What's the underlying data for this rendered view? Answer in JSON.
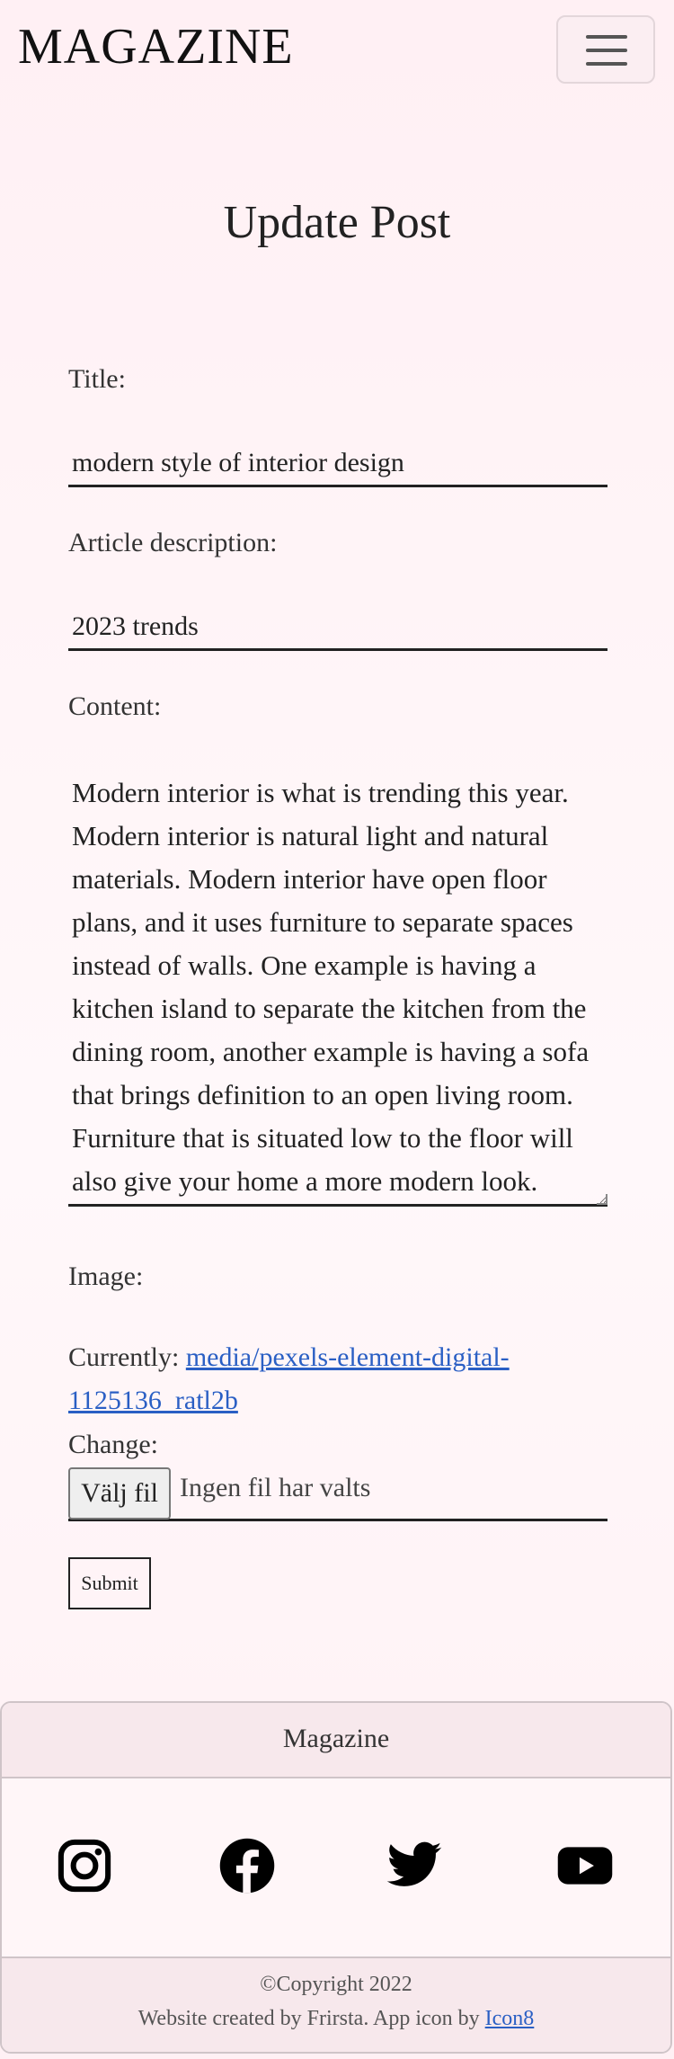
{
  "navbar": {
    "brand": "MAGAZINE",
    "toggler_icon": "hamburger-icon"
  },
  "page": {
    "title": "Update Post"
  },
  "form": {
    "title_label": "Title:",
    "title_value": "modern style of interior design",
    "description_label": "Article description:",
    "description_value": "2023 trends",
    "content_label": "Content:",
    "content_value": "Modern interior is what is trending this year. Modern interior is natural light and natural materials. Modern interior have open floor plans, and it uses furniture to separate spaces instead of walls. One example is having a kitchen island to separate the kitchen from the dining room, another example is having a sofa that brings definition to an open living room. Furniture that is situated low to the floor will also give your home a more modern look.",
    "image_label": "Image:",
    "currently_label": "Currently:",
    "current_file": "media/pexels-element-digital-1125136_ratl2b",
    "change_label": "Change:",
    "file_button": "Välj fil",
    "file_status": "Ingen fil har valts",
    "submit_label": "Submit"
  },
  "footer": {
    "title": "Magazine",
    "social_icons": [
      "instagram-icon",
      "facebook-icon",
      "twitter-icon",
      "youtube-icon"
    ],
    "copyright": "©Copyright 2022",
    "credit_text": "Website created by Frirsta. App icon by",
    "credit_link": "Icon8"
  }
}
